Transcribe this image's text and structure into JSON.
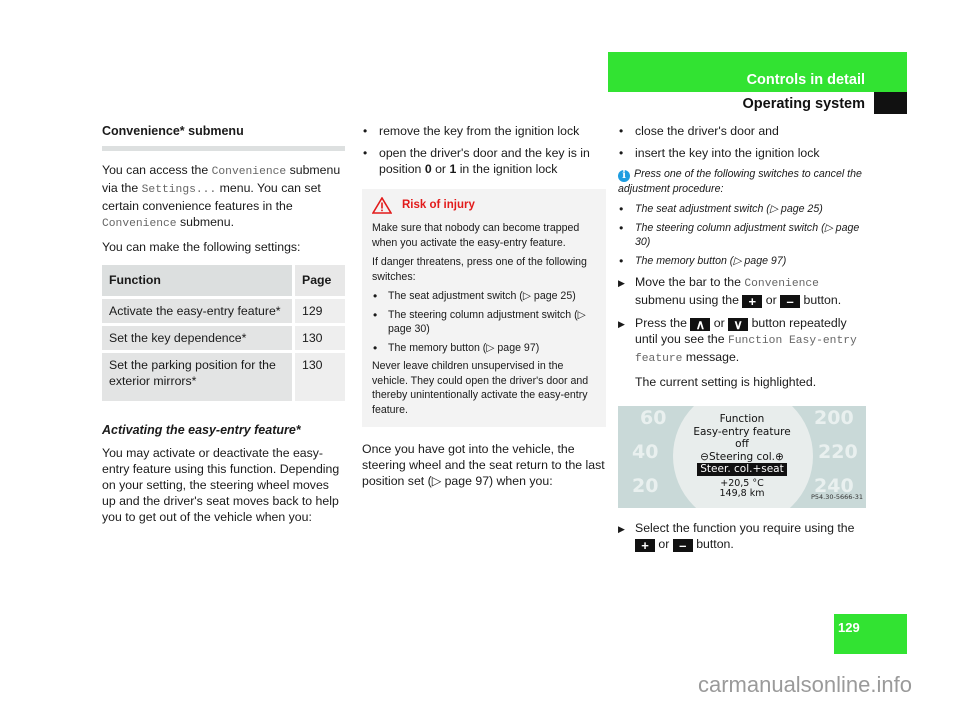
{
  "header": {
    "section": "Controls in detail",
    "subsection": "Operating system"
  },
  "col1": {
    "heading": "Convenience* submenu",
    "intro_p1": [
      {
        "t": "You can access the "
      },
      {
        "m": "Convenience"
      },
      {
        "t": " submenu via the "
      },
      {
        "m": "Settings..."
      },
      {
        "t": " menu. You can set certain convenience features in the "
      },
      {
        "m": "Convenience"
      },
      {
        "t": " submenu."
      }
    ],
    "intro_p2": "You can make the following settings:",
    "table": {
      "headers": [
        "Function",
        "Page"
      ],
      "rows": [
        [
          "Activate the easy-entry feature*",
          "129"
        ],
        [
          "Set the key dependence*",
          "130"
        ],
        [
          "Set the parking position for the exterior mirrors*",
          "130"
        ]
      ]
    },
    "subheading": "Activating the easy-entry feature*",
    "body": "You may activate or deactivate the easy-entry feature using this function. Depending on your setting, the steering wheel moves up and the driver's seat moves back to help you to get out of the vehicle when you:"
  },
  "col2": {
    "bullets": [
      "remove the key from the ignition lock",
      "open the driver's door and the key is in position {0} or {1} in the ignition lock"
    ],
    "bullet2_parts": [
      "open the driver's door and the key is in position ",
      "0",
      " or ",
      "1",
      " in the ignition lock"
    ],
    "warning": {
      "title": "Risk of injury",
      "p1": "Make sure that nobody can become trapped when you activate the easy-entry feature.",
      "p2": "If danger threatens, press one of the following switches:",
      "items": [
        "The seat adjustment switch (▷ page 25)",
        "The steering column adjustment switch (▷ page 30)",
        "The memory button (▷ page 97)"
      ],
      "p3": "Never leave children unsupervised in the vehicle. They could open the driver's door and thereby unintentionally activate the easy-entry feature."
    },
    "after": "Once you have got into the vehicle, the steering wheel and the seat return to the last position set (▷ page 97) when you:"
  },
  "col3": {
    "bullets": [
      "close the driver's door and",
      "insert the key into the ignition lock"
    ],
    "info": {
      "icon": "i",
      "text": "Press one of the following switches to cancel the adjustment procedure:",
      "items": [
        "The seat adjustment switch (▷ page 25)",
        "The steering column adjustment switch (▷ page 30)",
        "The memory button (▷ page 97)"
      ]
    },
    "step1": {
      "a": "Move the bar to the ",
      "m": "Convenience",
      "b": " submenu using the ",
      "or": " or ",
      "c": " button."
    },
    "step2": {
      "a": "Press the ",
      "or": " or ",
      "b": " button repeatedly until you see the ",
      "m": "Function Easy-entry feature",
      "c": " message."
    },
    "step2_note": "The current setting is highlighted.",
    "display": {
      "dials_left": [
        "60",
        "40",
        "20"
      ],
      "dials_right": [
        "200",
        "220",
        "240"
      ],
      "line1": "Function",
      "line2": "Easy-entry feature",
      "line3": "off",
      "line4": "Steering col.",
      "highlight": "Steer. col.+seat",
      "temp": "+20,5 °C",
      "dist": "149,8 km",
      "code": "P54.30-5666-31"
    },
    "step3": {
      "a": "Select the function you require using the ",
      "or": " or ",
      "b": " button."
    },
    "keys": {
      "plus": "+",
      "minus": "–",
      "up": "∧",
      "down": "∨"
    }
  },
  "page_number": "129",
  "watermark": "carmanualsonline.info"
}
